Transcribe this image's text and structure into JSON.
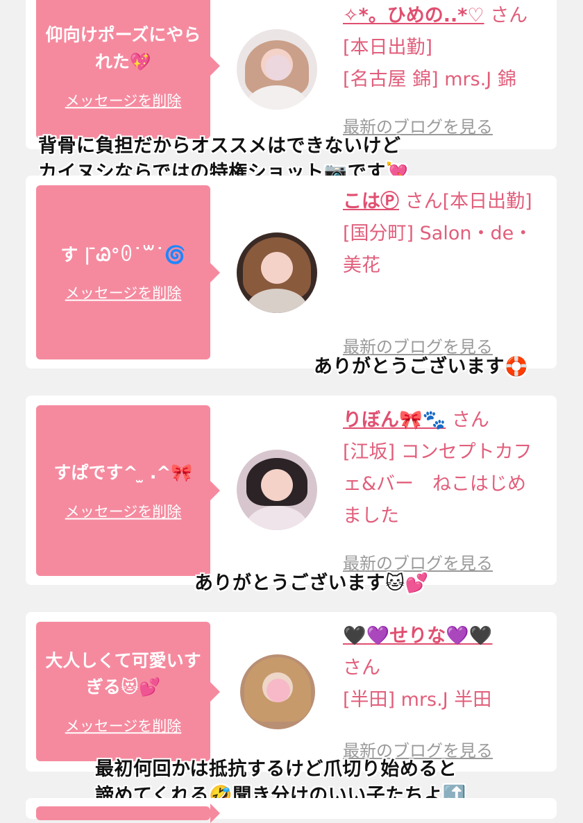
{
  "cards": [
    {
      "message": "仰向けポーズにやられた💖",
      "delete_label": "メッセージを削除",
      "name": "✧*。ひめの..*♡",
      "name_suffix": "さん[本日出勤]",
      "shop": "[名古屋 錦] mrs.J 錦",
      "blog_label": "最新のブログを見る"
    },
    {
      "message": "す | ̄Ꮚ°ꏿ˙꒳˙🌀",
      "delete_label": "メッセージを削除",
      "name": "こはⓅ",
      "name_suffix": "さん[本日出勤]",
      "shop": "[国分町] Salon・de・美花",
      "blog_label": "最新のブログを見る"
    },
    {
      "message": "すぱです^ ̫ .^🎀",
      "delete_label": "メッセージを削除",
      "name": "りぼん🎀🐾",
      "name_suffix": "さん",
      "shop": "[江坂] コンセプトカフェ&バー　ねこはじめました",
      "blog_label": "最新のブログを見る"
    },
    {
      "message": "大人しくて可愛いすぎる😻💕",
      "delete_label": "メッセージを削除",
      "name": "🖤💜せりな💜🖤",
      "name_suffix": "さん",
      "shop": "[半田] mrs.J 半田",
      "blog_label": "最新のブログを見る"
    }
  ],
  "captions": {
    "c1_line1": "背骨に負担だからオススメはできないけど",
    "c1_line2": "カイヌシならではの特権ショット📷です💘",
    "c2": "ありがとうございます🛟",
    "c3": "ありがとうございます🐱💕",
    "c4_line1": "最初何回かは抵抗するけど爪切り始めると",
    "c4_line2": "諦めてくれる🤣聞き分けのいい子たちよ⤴️"
  },
  "colors": {
    "page_bg": "#f1f1f1",
    "card_bg": "#ffffff",
    "bubble_bg": "#f58a9f",
    "accent_text": "#e15e7b",
    "link_gray": "#9a9a9a"
  }
}
